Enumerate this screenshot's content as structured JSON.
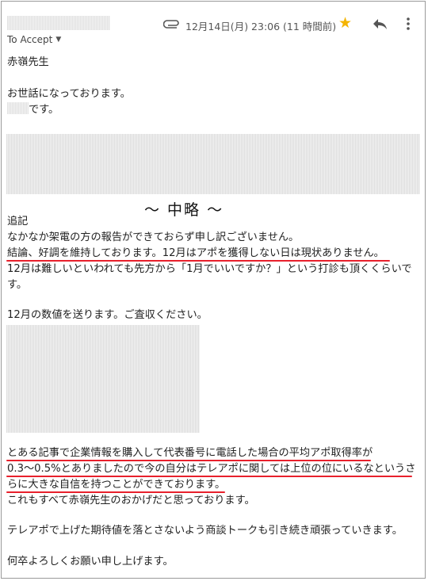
{
  "header": {
    "to_label": "To Accept",
    "date": "12月14日(月) 23:06 (11 時間前)",
    "icons": {
      "attachment": "paperclip-icon",
      "star": "star-icon",
      "reply": "reply-icon",
      "more": "more-vert-icon"
    },
    "star_color": "#f4b400"
  },
  "email": {
    "greeting": "赤嶺先生",
    "intro": "お世話になっております。",
    "self_suffix": "です。",
    "omitted_marker": "〜 中略 〜",
    "postscript_label": "追記",
    "p1_line1": "なかなか架電の方の報告ができておらず申し訳ございません。",
    "p1_line2": "結論、好調を維持しております。12月はアポを獲得しない日は現状ありません。",
    "p1_line3": "12月は難しいといわれても先方から「1月でいいですか？」という打診も頂くくらいで",
    "p1_line4": "す。",
    "p2": "12月の数値を送ります。ご査収ください。",
    "p3_line1": "とある記事で企業情報を購入して代表番号に電話した場合の平均アポ取得率が",
    "p3_line2": "0.3〜0.5%とありましたので今の自分はテレアポに関しては上位の位にいるなというさ",
    "p3_line3": "らに大きな自信を持つことができております。",
    "p3_line4": "これもすべて赤嶺先生のおかげだと思っております。",
    "p4": "テレアポで上げた期待値を落とさないよう商談トークも引き続き頑張っていきます。",
    "closing": "何卒よろしくお願い申し上げます。"
  },
  "colors": {
    "underline": "#e8202c"
  }
}
